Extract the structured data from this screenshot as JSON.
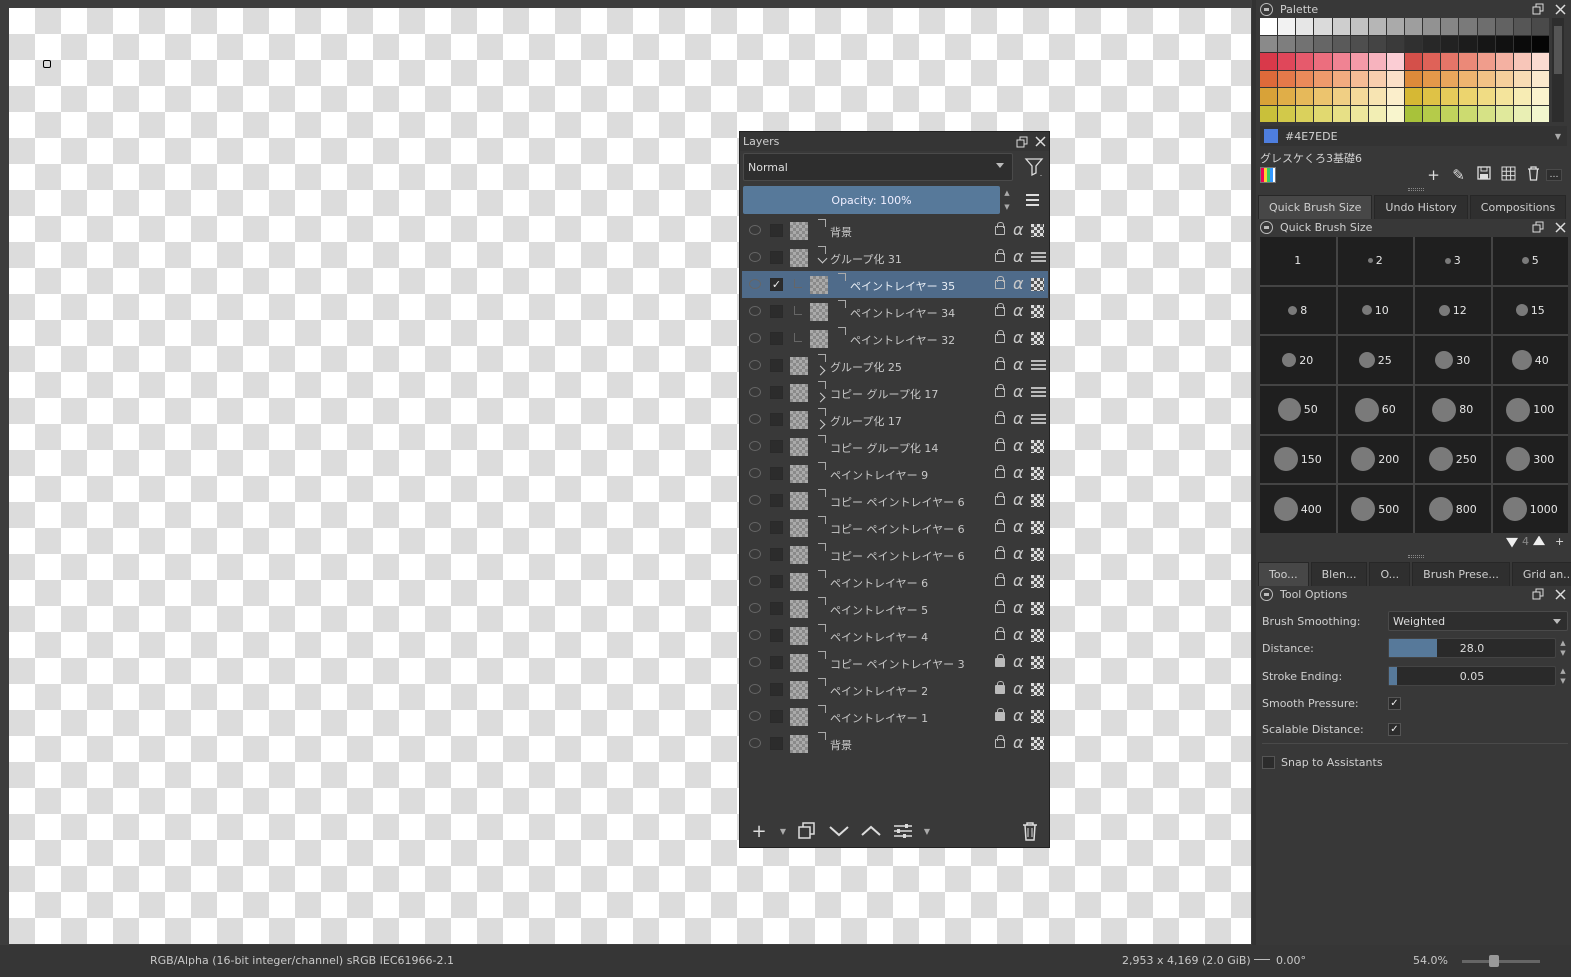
{
  "canvas": {
    "checker_light": "#ffffff",
    "checker_dark": "#dcdcdc"
  },
  "layers": {
    "title": "Layers",
    "blend_mode": "Normal",
    "opacity_label": "Opacity:  100%",
    "items": [
      {
        "name": "背景",
        "depth": 0,
        "kind": "paint",
        "visible": false,
        "checked": false,
        "selected": false,
        "locked": false,
        "group_state": ""
      },
      {
        "name": "グループ化 31",
        "depth": 0,
        "kind": "group",
        "visible": false,
        "checked": false,
        "selected": false,
        "locked": false,
        "group_state": "expanded"
      },
      {
        "name": "ペイントレイヤー 35",
        "depth": 1,
        "kind": "paint",
        "visible": false,
        "checked": true,
        "selected": true,
        "locked": false,
        "group_state": ""
      },
      {
        "name": "ペイントレイヤー 34",
        "depth": 1,
        "kind": "paint",
        "visible": false,
        "checked": false,
        "selected": false,
        "locked": false,
        "group_state": ""
      },
      {
        "name": "ペイントレイヤー 32",
        "depth": 1,
        "kind": "paint",
        "visible": false,
        "checked": false,
        "selected": false,
        "locked": false,
        "group_state": ""
      },
      {
        "name": "グループ化 25",
        "depth": 0,
        "kind": "group",
        "visible": false,
        "checked": false,
        "selected": false,
        "locked": false,
        "group_state": "collapsed"
      },
      {
        "name": "コピー グループ化 17",
        "depth": 0,
        "kind": "group",
        "visible": false,
        "checked": false,
        "selected": false,
        "locked": false,
        "group_state": "collapsed"
      },
      {
        "name": "グループ化 17",
        "depth": 0,
        "kind": "group",
        "visible": false,
        "checked": false,
        "selected": false,
        "locked": false,
        "group_state": "collapsed"
      },
      {
        "name": "コピー グループ化 14",
        "depth": 0,
        "kind": "paint",
        "visible": false,
        "checked": false,
        "selected": false,
        "locked": false,
        "group_state": ""
      },
      {
        "name": "ペイントレイヤー 9",
        "depth": 0,
        "kind": "paint",
        "visible": false,
        "checked": false,
        "selected": false,
        "locked": false,
        "group_state": ""
      },
      {
        "name": "コピー ペイントレイヤー 6",
        "depth": 0,
        "kind": "paint",
        "visible": false,
        "checked": false,
        "selected": false,
        "locked": false,
        "group_state": ""
      },
      {
        "name": "コピー ペイントレイヤー 6",
        "depth": 0,
        "kind": "paint",
        "visible": false,
        "checked": false,
        "selected": false,
        "locked": false,
        "group_state": ""
      },
      {
        "name": "コピー ペイントレイヤー 6",
        "depth": 0,
        "kind": "paint",
        "visible": false,
        "checked": false,
        "selected": false,
        "locked": false,
        "group_state": ""
      },
      {
        "name": "ペイントレイヤー 6",
        "depth": 0,
        "kind": "paint",
        "visible": false,
        "checked": false,
        "selected": false,
        "locked": false,
        "group_state": ""
      },
      {
        "name": "ペイントレイヤー 5",
        "depth": 0,
        "kind": "paint",
        "visible": false,
        "checked": false,
        "selected": false,
        "locked": false,
        "group_state": ""
      },
      {
        "name": "ペイントレイヤー 4",
        "depth": 0,
        "kind": "paint",
        "visible": false,
        "checked": false,
        "selected": false,
        "locked": false,
        "group_state": ""
      },
      {
        "name": "コピー ペイントレイヤー 3",
        "depth": 0,
        "kind": "paint",
        "visible": false,
        "checked": false,
        "selected": false,
        "locked": true,
        "group_state": ""
      },
      {
        "name": "ペイントレイヤー 2",
        "depth": 0,
        "kind": "paint",
        "visible": false,
        "checked": false,
        "selected": false,
        "locked": true,
        "group_state": ""
      },
      {
        "name": "ペイントレイヤー 1",
        "depth": 0,
        "kind": "paint",
        "visible": false,
        "checked": false,
        "selected": false,
        "locked": true,
        "group_state": ""
      },
      {
        "name": "背景",
        "depth": 0,
        "kind": "paint",
        "visible": false,
        "checked": false,
        "selected": false,
        "locked": false,
        "group_state": ""
      }
    ]
  },
  "palette": {
    "title": "Palette",
    "current_color_hex": "#4E7EDE",
    "current_color": "#4e7ede",
    "palette_name": "グレスケくろ3基礎6",
    "rows": [
      [
        "#ffffff",
        "#f2f2f2",
        "#e6e6e6",
        "#dadada",
        "#cecece",
        "#c2c2c2",
        "#b6b6b6",
        "#aaaaaa",
        "#9e9e9e",
        "#929292",
        "#868686",
        "#7a7a7a",
        "#6e6e6e",
        "#626262",
        "#565656",
        "#4a4a4a"
      ],
      [
        "#8a8a8a",
        "#7e7e7e",
        "#727272",
        "#666666",
        "#5a5a5a",
        "#4e4e4e",
        "#444444",
        "#3a3a3a",
        "#303030",
        "#282828",
        "#222222",
        "#1c1c1c",
        "#161616",
        "#111111",
        "#0b0b0b",
        "#050505"
      ],
      [
        "#d9394a",
        "#e0475a",
        "#e65a6c",
        "#ec6e7e",
        "#f08393",
        "#f49aa8",
        "#f7b3be",
        "#fbcdd4",
        "#d4504a",
        "#df6258",
        "#e57568",
        "#eb8978",
        "#f09d8c",
        "#f4b1a2",
        "#f8c6b9",
        "#fbdbd1"
      ],
      [
        "#de6a3a",
        "#e4794a",
        "#ea8a5a",
        "#ee9a6c",
        "#f2ab80",
        "#f5bc96",
        "#f8ceae",
        "#fbe0c8",
        "#dd8a3a",
        "#e4984a",
        "#e9a65c",
        "#eeb470",
        "#f2c286",
        "#f5cf9c",
        "#f8dcb4",
        "#fbe9cd"
      ],
      [
        "#d8a238",
        "#e0ae48",
        "#e6b95a",
        "#ecc46e",
        "#f0cf84",
        "#f4da9a",
        "#f7e4b2",
        "#fbeecb",
        "#d6b834",
        "#dfc246",
        "#e6cb5a",
        "#ecd46e",
        "#f0dc84",
        "#f4e49c",
        "#f7ecb4",
        "#fbf3cd"
      ],
      [
        "#c9c03a",
        "#d2c94a",
        "#dad15c",
        "#e1d970",
        "#e7e086",
        "#ede79c",
        "#f2eeb4",
        "#f8f5cd",
        "#a8c23a",
        "#b5cb4a",
        "#c1d35c",
        "#ccdb70",
        "#d6e286",
        "#e0e99c",
        "#e9efb4",
        "#f2f6cd"
      ]
    ]
  },
  "tabs_top": [
    "Quick Brush Size",
    "Undo History",
    "Compositions"
  ],
  "quick_brush": {
    "title": "Quick Brush Size",
    "sizes": [
      "1",
      "2",
      "3",
      "5",
      "8",
      "10",
      "12",
      "15",
      "20",
      "25",
      "30",
      "40",
      "50",
      "60",
      "80",
      "100",
      "150",
      "200",
      "250",
      "300",
      "400",
      "500",
      "800",
      "1000"
    ],
    "counter": "4"
  },
  "tabs_bottom": [
    "Too...",
    "Blen...",
    "O...",
    "Brush Prese...",
    "Grid an..."
  ],
  "tool_options": {
    "title": "Tool Options",
    "brush_smoothing_label": "Brush Smoothing:",
    "brush_smoothing_value": "Weighted",
    "distance_label": "Distance:",
    "distance_value": "28.0",
    "distance_fraction": 0.29,
    "stroke_ending_label": "Stroke Ending:",
    "stroke_ending_value": "0.05",
    "stroke_ending_fraction": 0.05,
    "smooth_pressure_label": "Smooth Pressure:",
    "smooth_pressure_checked": true,
    "scalable_distance_label": "Scalable Distance:",
    "scalable_distance_checked": true,
    "snap_label": "Snap to Assistants",
    "snap_checked": false
  },
  "status": {
    "color_model": "RGB/Alpha (16-bit integer/channel)  sRGB IEC61966-2.1",
    "image_size": "2,953 x 4,169 (2.0 GiB)",
    "rotation": "0.00°",
    "zoom": "54.0%",
    "zoom_fraction": 0.35
  }
}
